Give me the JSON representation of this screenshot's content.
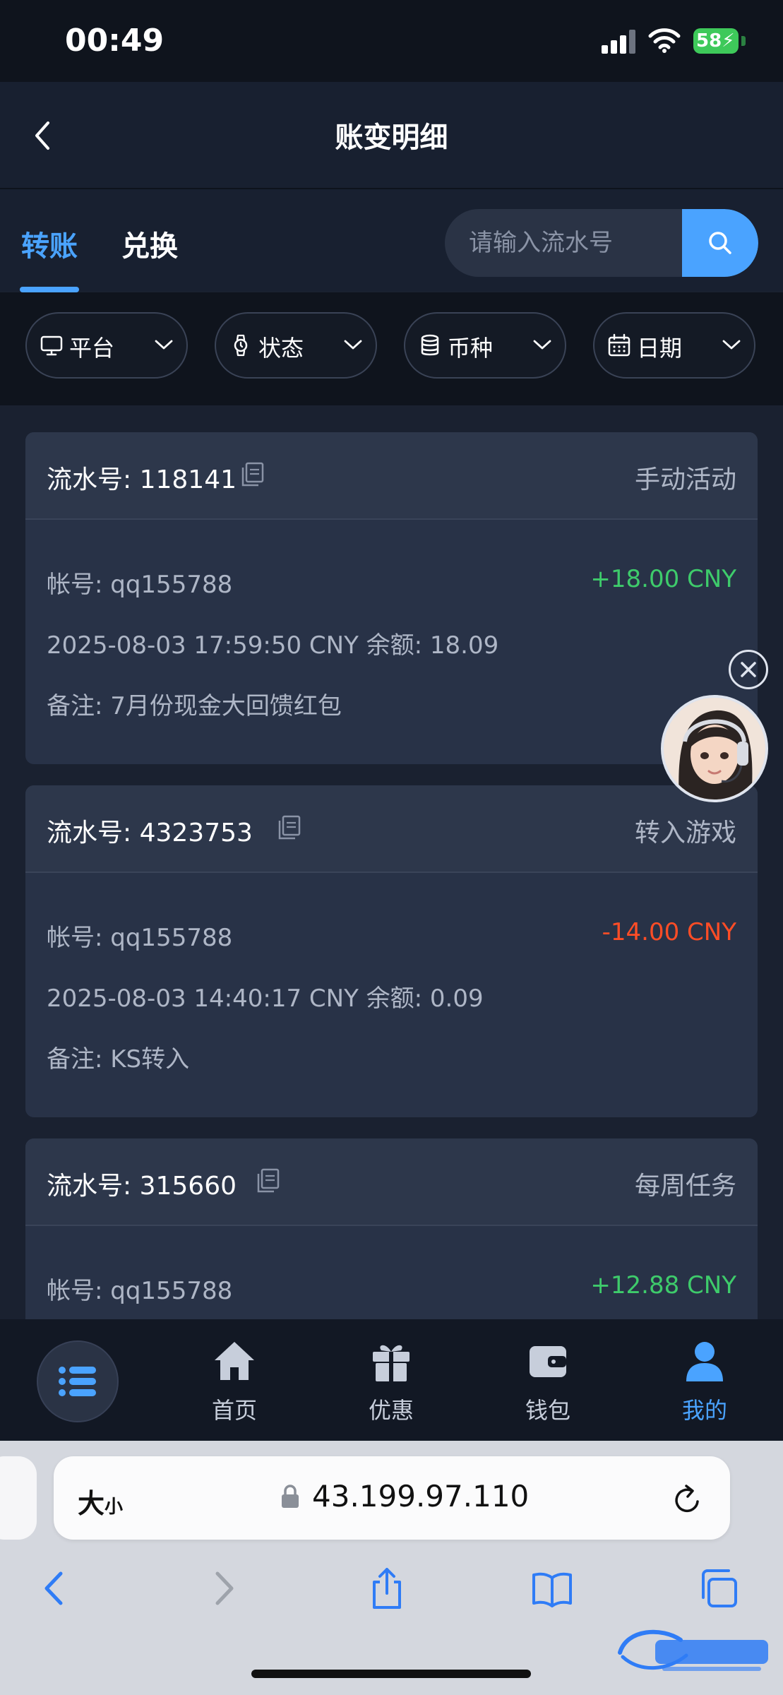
{
  "status": {
    "time": "00:49",
    "battery": "58"
  },
  "header": {
    "title": "账变明细"
  },
  "tabs": [
    {
      "label": "转账",
      "active": true
    },
    {
      "label": "兑换",
      "active": false
    }
  ],
  "search": {
    "placeholder": "请输入流水号"
  },
  "filters": [
    {
      "label": "平台",
      "icon": "monitor-icon"
    },
    {
      "label": "状态",
      "icon": "watch-icon"
    },
    {
      "label": "币种",
      "icon": "database-icon"
    },
    {
      "label": "日期",
      "icon": "calendar-icon"
    }
  ],
  "records": [
    {
      "serial_label": "流水号: ",
      "serial": "118141",
      "type": "手动活动",
      "account": "帐号: qq155788",
      "amount": "+18.00 CNY",
      "direction": "positive",
      "time_balance": "2025-08-03 17:59:50 CNY 余额: 18.09",
      "note": "备注: 7月份现金大回馈红包"
    },
    {
      "serial_label": "流水号: ",
      "serial": "4323753",
      "type": "转入游戏",
      "account": "帐号: qq155788",
      "amount": "-14.00 CNY",
      "direction": "negative",
      "time_balance": "2025-08-03 14:40:17 CNY 余额: 0.09",
      "note": "备注: KS转入"
    },
    {
      "serial_label": "流水号: ",
      "serial": "315660",
      "type": "每周任务",
      "account": "帐号: qq155788",
      "amount": "+12.88 CNY",
      "direction": "positive"
    }
  ],
  "tabbar": [
    {
      "label": "首页",
      "icon": "home-icon"
    },
    {
      "label": "优惠",
      "icon": "gift-icon"
    },
    {
      "label": "钱包",
      "icon": "wallet-icon"
    },
    {
      "label": "我的",
      "icon": "user-icon",
      "active": true
    }
  ],
  "browser": {
    "text_size": "大",
    "text_size_small": "小",
    "url": "43.199.97.110"
  },
  "colors": {
    "accent": "#4aa3ff",
    "positive": "#3ecb6b",
    "negative": "#ff4d26",
    "card": "#283247",
    "background": "#1a2130"
  }
}
